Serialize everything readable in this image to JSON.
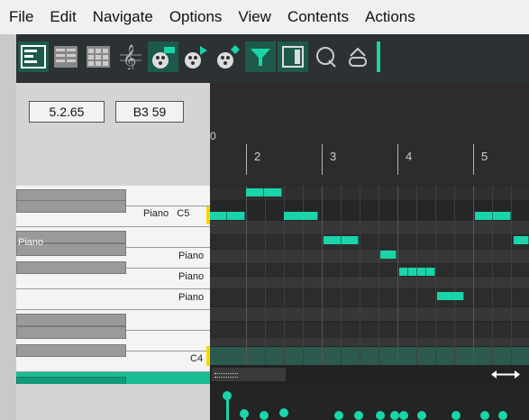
{
  "menu": [
    "File",
    "Edit",
    "Navigate",
    "Options",
    "View",
    "Contents",
    "Actions"
  ],
  "toolbar": {
    "icons": [
      "piano-roll-view-icon",
      "named-notes-view-icon",
      "drum-grid-view-icon",
      "notation-treble-clef-icon",
      "media-item-icon",
      "item-play-icon",
      "item-diamond-icon",
      "filter-icon",
      "side-panel-icon",
      "quantize-icon",
      "chord-icon"
    ]
  },
  "position": {
    "time": "5.2.65",
    "note": "B3 59"
  },
  "ruler": {
    "start": "0",
    "bars": [
      "2",
      "3",
      "4",
      "5"
    ]
  },
  "piano": {
    "labels": [
      "Piano   C5",
      "Piano",
      "Piano",
      "Piano",
      "Piano",
      "C4"
    ]
  },
  "colors": {
    "note": "#19d5a9",
    "cursor": "#ffd400",
    "active_tool": "#1e5a4c"
  }
}
